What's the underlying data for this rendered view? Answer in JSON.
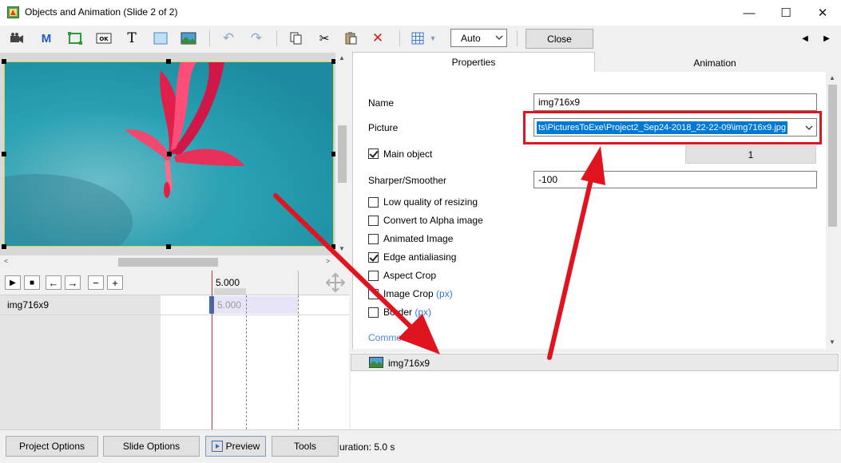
{
  "window": {
    "title": "Objects and Animation (Slide 2 of 2)",
    "minimize": "—",
    "maximize": "☐",
    "close": "✕"
  },
  "toolbar": {
    "zoom_select": "Auto",
    "close_label": "Close",
    "nav_prev": "◀",
    "nav_next": "▶"
  },
  "timeline": {
    "controls": [
      "▶",
      "■",
      "←",
      "→",
      "−",
      "+"
    ],
    "ruler_time": "5.000",
    "rows": [
      {
        "name": "img716x9",
        "time": "5.000"
      }
    ]
  },
  "tabs": {
    "properties": "Properties",
    "animation": "Animation"
  },
  "properties": {
    "name_label": "Name",
    "name_value": "img716x9",
    "picture_label": "Picture",
    "picture_value": "ts\\PicturesToExe\\Project2_Sep24-2018_22-22-09\\img716x9.jpg",
    "main_object_label": "Main object",
    "main_object_checked": true,
    "main_object_number": "1",
    "sharper_label": "Sharper/Smoother",
    "sharper_value": "-100",
    "checkboxes": [
      {
        "label": "Low quality of resizing",
        "checked": false
      },
      {
        "label": "Convert to Alpha image",
        "checked": false
      },
      {
        "label": "Animated Image",
        "checked": false
      },
      {
        "label": "Edge antialiasing",
        "checked": true
      },
      {
        "label": "Aspect Crop",
        "checked": false
      },
      {
        "label": "Image Crop",
        "checked": false,
        "suffix": "(px)"
      },
      {
        "label": "Border",
        "checked": false,
        "suffix": "(px)"
      }
    ],
    "common_label": "Common"
  },
  "object_list": [
    {
      "name": "img716x9"
    }
  ],
  "bottom": {
    "project_options": "Project Options",
    "slide_options": "Slide Options",
    "preview": "Preview",
    "tools": "Tools",
    "duration": "uration: 5.0 s"
  },
  "colors": {
    "annotation_red": "#e0141e",
    "selection_blue": "#0078d7",
    "link_blue": "#2e78d6"
  }
}
